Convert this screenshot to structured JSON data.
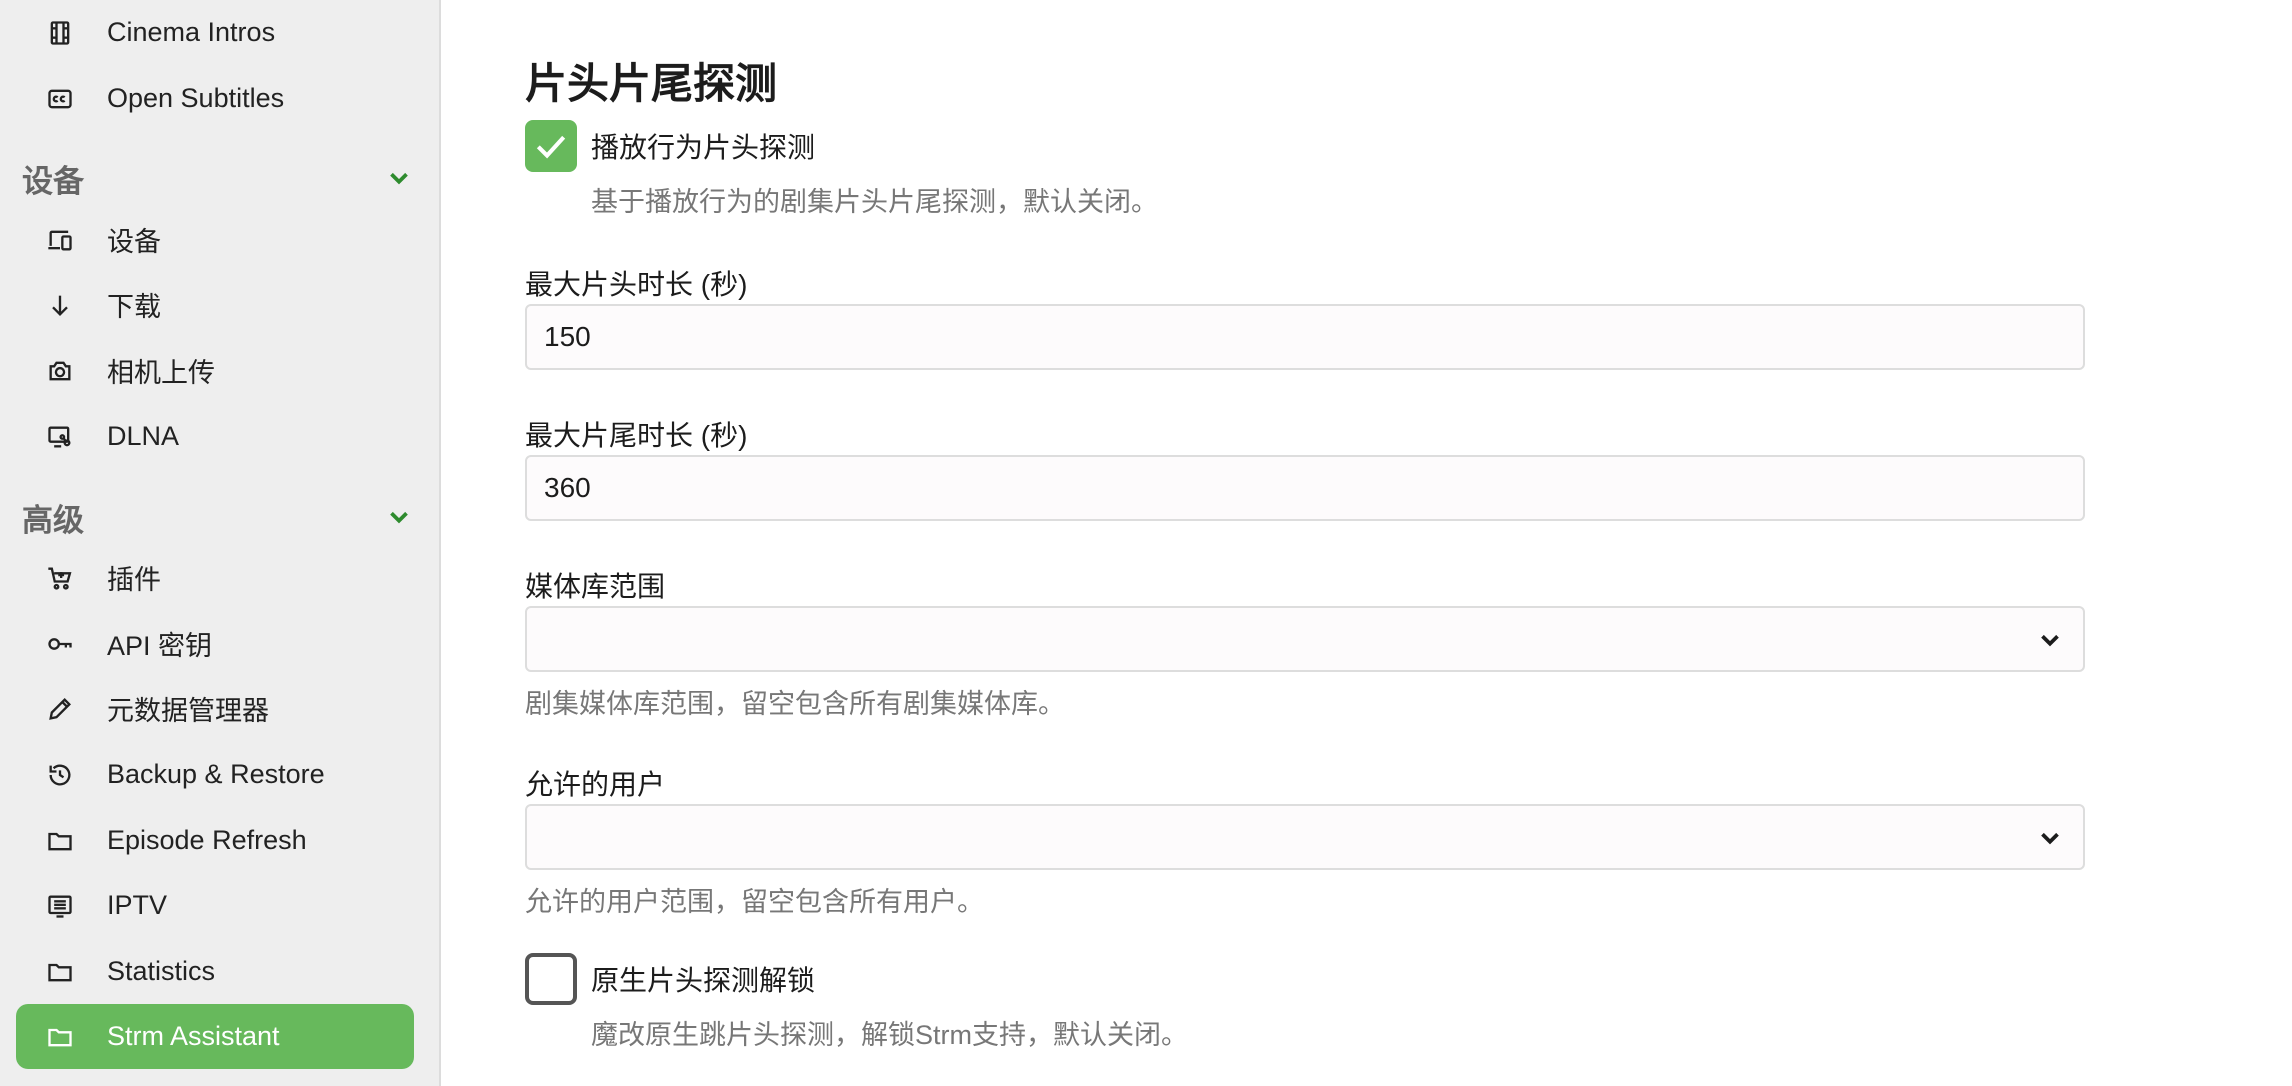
{
  "sidebar": {
    "top_items": [
      {
        "label": "Cinema Intros",
        "icon": "film-icon"
      },
      {
        "label": "Open Subtitles",
        "icon": "closed-captions-icon"
      }
    ],
    "sections": [
      {
        "title": "设备",
        "items": [
          {
            "label": "设备",
            "icon": "devices-icon"
          },
          {
            "label": "下载",
            "icon": "download-arrow-icon"
          },
          {
            "label": "相机上传",
            "icon": "camera-icon"
          },
          {
            "label": "DLNA",
            "icon": "dlna-icon"
          }
        ]
      },
      {
        "title": "高级",
        "items": [
          {
            "label": "插件",
            "icon": "cart-icon"
          },
          {
            "label": "API 密钥",
            "icon": "key-icon"
          },
          {
            "label": "元数据管理器",
            "icon": "pencil-icon"
          },
          {
            "label": "Backup & Restore",
            "icon": "history-icon"
          },
          {
            "label": "Episode Refresh",
            "icon": "folder-icon"
          },
          {
            "label": "IPTV",
            "icon": "list-icon"
          },
          {
            "label": "Statistics",
            "icon": "folder-icon"
          },
          {
            "label": "Strm Assistant",
            "icon": "folder-icon",
            "active": true
          }
        ]
      }
    ],
    "active_color": "#67b95c"
  },
  "main": {
    "title": "片头片尾探测",
    "playback_detect": {
      "label": "播放行为片头探测",
      "checked": true,
      "description": "基于播放行为的剧集片头片尾探测，默认关闭。"
    },
    "max_intro": {
      "label": "最大片头时长 (秒)",
      "value": "150"
    },
    "max_credits": {
      "label": "最大片尾时长 (秒)",
      "value": "360"
    },
    "library_scope": {
      "label": "媒体库范围",
      "value": "",
      "description": "剧集媒体库范围，留空包含所有剧集媒体库。"
    },
    "allowed_users": {
      "label": "允许的用户",
      "value": "",
      "description": "允许的用户范围，留空包含所有用户。"
    },
    "native_unlock": {
      "label": "原生片头探测解锁",
      "checked": false,
      "description": "魔改原生跳片头探测，解锁Strm支持，默认关闭。"
    }
  }
}
